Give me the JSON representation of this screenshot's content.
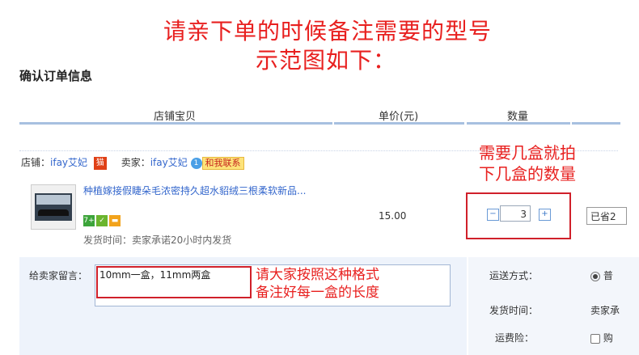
{
  "banner": {
    "line1": "请亲下单的时候备注需要的型号",
    "line2": "示范图如下："
  },
  "section_title": "确认订单信息",
  "columns": {
    "item": "店铺宝贝",
    "price": "单价(元)",
    "quantity": "数量"
  },
  "shop": {
    "shop_prefix": "店铺：",
    "shop_name": "ifay艾妃",
    "tmall_badge": "猫",
    "seller_prefix": "卖家：",
    "seller_name": "ifay艾妃",
    "contact_label": "和我联系"
  },
  "item": {
    "title": "种植嫁接假睫朵毛浓密持久超水貂绒三根柔软新品...",
    "badge_7": "7+",
    "ship_time": "发货时间：卖家承诺20小时内发货",
    "price": "15.00",
    "quantity": "3",
    "minus": "−",
    "plus": "+",
    "saved": "已省2"
  },
  "annotations": {
    "qty_line1": "需要几盒就拍",
    "qty_line2": "下几盒的数量",
    "note_line1": "请大家按照这种格式",
    "note_line2": "备注好每一盒的长度"
  },
  "message": {
    "label": "给卖家留言：",
    "value": "10mm一盒，11mm两盒"
  },
  "shipping": {
    "method_label": "运送方式：",
    "method_value": "普",
    "time_label": "发货时间：",
    "time_value": "卖家承",
    "insurance_label": "运费险：",
    "insurance_value": "购"
  },
  "colors": {
    "annotation_red": "#e8201f",
    "link_blue": "#3366cc",
    "header_bar": "#a7c0e0"
  }
}
